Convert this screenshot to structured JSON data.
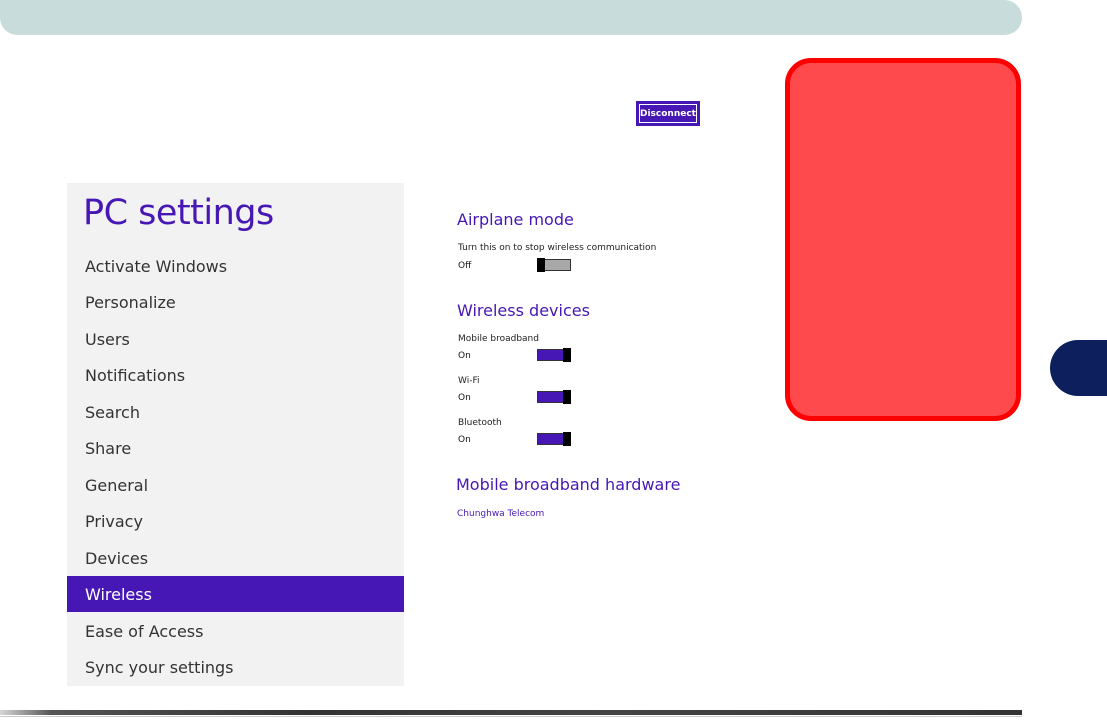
{
  "toolbar": {
    "disconnect_label": "Disconnect"
  },
  "sidebar": {
    "title": "PC settings",
    "items": [
      {
        "label": "Activate Windows",
        "selected": false
      },
      {
        "label": "Personalize",
        "selected": false
      },
      {
        "label": "Users",
        "selected": false
      },
      {
        "label": "Notifications",
        "selected": false
      },
      {
        "label": "Search",
        "selected": false
      },
      {
        "label": "Share",
        "selected": false
      },
      {
        "label": "General",
        "selected": false
      },
      {
        "label": "Privacy",
        "selected": false
      },
      {
        "label": "Devices",
        "selected": false
      },
      {
        "label": "Wireless",
        "selected": true
      },
      {
        "label": "Ease of Access",
        "selected": false
      },
      {
        "label": "Sync your settings",
        "selected": false
      }
    ]
  },
  "main": {
    "airplane": {
      "heading": "Airplane mode",
      "description": "Turn this on to stop wireless communication",
      "state": "Off",
      "on": false
    },
    "wireless": {
      "heading": "Wireless devices",
      "devices": [
        {
          "name": "Mobile broadband",
          "state": "On",
          "on": true
        },
        {
          "name": "Wi-Fi",
          "state": "On",
          "on": true
        },
        {
          "name": "Bluetooth",
          "state": "On",
          "on": true
        }
      ]
    },
    "hardware": {
      "heading": "Mobile broadband hardware",
      "link": "Chunghwa Telecom"
    }
  },
  "colors": {
    "accent": "#4617b4",
    "header": "#c8dcdc",
    "sidebar_bg": "#f2f2f2",
    "red_panel": "#ff4a4d",
    "red_border": "#ff0000",
    "chapter_tab": "#0d1f5c"
  }
}
